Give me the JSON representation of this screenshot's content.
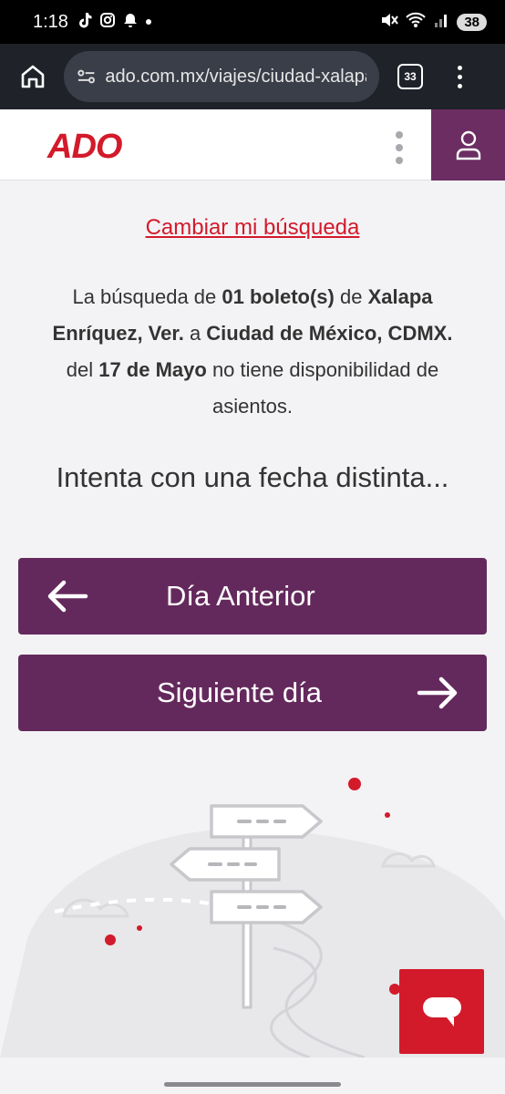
{
  "status_bar": {
    "time": "1:18",
    "battery": "38",
    "icons": [
      "tiktok-icon",
      "instagram-icon",
      "notification-bell-icon",
      "dot-icon",
      "mute-icon",
      "wifi-icon",
      "signal-icon"
    ]
  },
  "browser": {
    "url": "ado.com.mx/viajes/ciudad-xalapa",
    "tab_count": "33"
  },
  "site": {
    "logo_text": "ADO",
    "brand_color": "#d31a2b",
    "accent_color": "#64295c"
  },
  "main": {
    "change_search_label": "Cambiar mi búsqueda",
    "message": {
      "p1": "La búsqueda de ",
      "tickets": "01 boleto(s)",
      "p2": " de ",
      "origin": "Xalapa Enríquez, Ver.",
      "p3": " a ",
      "destination": "Ciudad de México, CDMX.",
      "p4": " del ",
      "date": "17 de Mayo",
      "p5": " no tiene disponibilidad de asientos."
    },
    "suggestion": "Intenta con una fecha distinta...",
    "prev_day_label": "Día Anterior",
    "next_day_label": "Siguiente día"
  }
}
